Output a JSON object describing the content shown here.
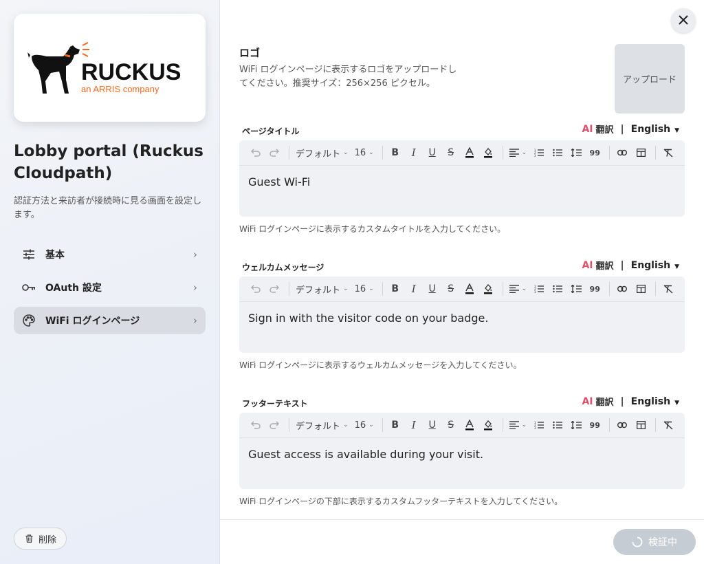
{
  "sidebar": {
    "logo": {
      "brand": "RUCKUS",
      "tagline": "an ARRIS company",
      "brand_color": "#111111",
      "accent": "#f26a21"
    },
    "title": "Lobby portal (Ruckus Cloudpath)",
    "description": "認証方法と来訪者が接続時に見る画面を設定します。",
    "nav": [
      {
        "label": "基本",
        "icon": "sliders-icon"
      },
      {
        "label": "OAuth 設定",
        "icon": "key-icon"
      },
      {
        "label": "WiFi ログインページ",
        "icon": "palette-icon",
        "active": true
      }
    ],
    "delete_label": "削除"
  },
  "main": {
    "logo_section": {
      "title": "ロゴ",
      "description": "WiFi ログインページに表示するロゴをアップロードしてください。推奨サイズ：256×256 ピクセル。",
      "upload_label": "アップロード"
    },
    "toolbar": {
      "font": "デフォルト",
      "size": "16",
      "quote": "99"
    },
    "translate": {
      "ai": "AI",
      "translate_label": "翻訳",
      "separator": "|",
      "language": "English"
    },
    "fields": [
      {
        "label": "ページタイトル",
        "content": "Guest Wi-Fi",
        "hint": "WiFi ログインページに表示するカスタムタイトルを入力してください。"
      },
      {
        "label": "ウェルカムメッセージ",
        "content": "Sign in with the visitor code on your badge.",
        "hint": "WiFi ログインページに表示するウェルカムメッセージを入力してください。"
      },
      {
        "label": "フッターテキスト",
        "content": "Guest access is available during your visit.",
        "hint": "WiFi ログインページの下部に表示するカスタムフッターテキストを入力してください。"
      }
    ],
    "verify_label": "検証中",
    "colors": {
      "ai_accent": "#e0506a",
      "verify_disabled": "#c6ccd4"
    }
  }
}
